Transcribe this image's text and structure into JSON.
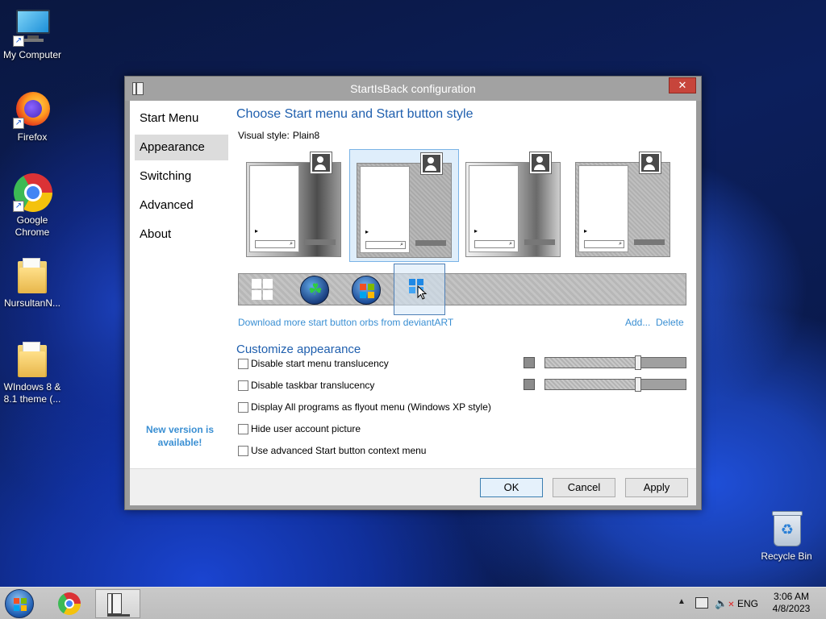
{
  "desktop": {
    "icons": [
      {
        "label": "My Computer"
      },
      {
        "label": "Firefox"
      },
      {
        "label": "Google Chrome"
      },
      {
        "label": "NursultanN..."
      },
      {
        "label": "WIndows 8 & 8.1 theme (..."
      },
      {
        "label": "Recycle Bin"
      }
    ]
  },
  "window": {
    "title": "StartIsBack configuration",
    "close_label": "✕",
    "nav": [
      {
        "label": "Start Menu"
      },
      {
        "label": "Appearance"
      },
      {
        "label": "Switching"
      },
      {
        "label": "Advanced"
      },
      {
        "label": "About"
      }
    ],
    "active_nav": "Appearance",
    "new_version": "New version is available!",
    "heading": "Choose Start menu and Start button style",
    "visual_style_label": "Visual style:",
    "visual_style_value": "Plain8",
    "styles": [
      "style-1",
      "style-2",
      "style-3",
      "style-4"
    ],
    "selected_style_index": 1,
    "orbs": [
      "windows-8-orb",
      "clover-orb",
      "windows-7-orb",
      "windows-11-orb"
    ],
    "selected_orb_index": 3,
    "download_link": "Download more start button orbs from deviantART",
    "add_link": "Add...",
    "delete_link": "Delete",
    "customize_heading": "Customize appearance",
    "options": [
      {
        "label": "Disable start menu translucency",
        "checked": false
      },
      {
        "label": "Disable taskbar translucency",
        "checked": false
      },
      {
        "label": "Display All programs as flyout menu (Windows XP style)",
        "checked": false
      },
      {
        "label": "Hide user account picture",
        "checked": false
      },
      {
        "label": "Use advanced Start button context menu",
        "checked": false
      }
    ],
    "sliders": [
      {
        "value": 0.66
      },
      {
        "value": 0.66
      }
    ],
    "buttons": {
      "ok": "OK",
      "cancel": "Cancel",
      "apply": "Apply"
    }
  },
  "taskbar": {
    "apps": [
      "Google Chrome",
      "StartIsBack configuration"
    ],
    "lang": "ENG",
    "time": "3:06 AM",
    "date": "4/8/2023"
  }
}
